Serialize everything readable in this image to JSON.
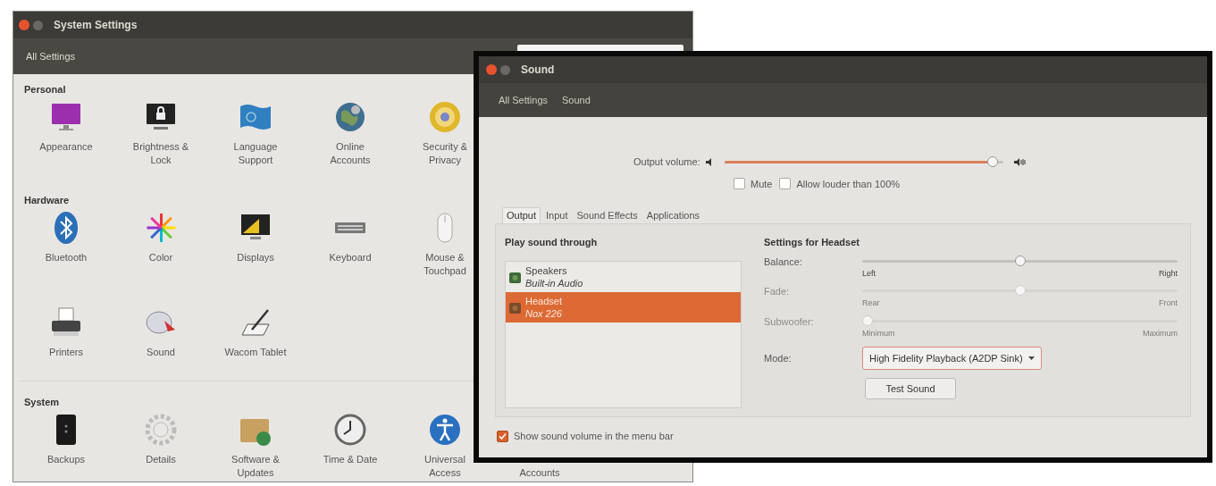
{
  "settings_window": {
    "title": "System Settings",
    "toolbar": {
      "button": "All Settings"
    },
    "sections": [
      {
        "heading": "Personal",
        "rows": [
          [
            {
              "kind": "tile",
              "label": "Appearance"
            },
            {
              "kind": "tile",
              "label": "Brightness &\nLock"
            },
            {
              "kind": "tile",
              "label": "Language\nSupport"
            },
            {
              "kind": "tile",
              "label": "Online\nAccounts"
            },
            {
              "kind": "tile",
              "label": "Security &\nPrivacy"
            }
          ]
        ]
      },
      {
        "heading": "Hardware",
        "rows": [
          [
            {
              "kind": "tile",
              "label": "Bluetooth"
            },
            {
              "kind": "tile",
              "label": "Color"
            },
            {
              "kind": "tile",
              "label": "Displays"
            },
            {
              "kind": "tile",
              "label": "Keyboard"
            },
            {
              "kind": "tile",
              "label": "Mouse &\nTouchpad"
            }
          ],
          [
            {
              "kind": "tile",
              "label": "Printers"
            },
            {
              "kind": "tile",
              "label": "Sound"
            },
            {
              "kind": "tile",
              "label": "Wacom Tablet"
            }
          ]
        ]
      },
      {
        "heading": "System",
        "rows": [
          [
            {
              "kind": "tile",
              "label": "Backups"
            },
            {
              "kind": "tile",
              "label": "Details"
            },
            {
              "kind": "tile",
              "label": "Software &\nUpdates"
            },
            {
              "kind": "tile",
              "label": "Time & Date"
            },
            {
              "kind": "tile",
              "label": "Universal\nAccess"
            },
            {
              "kind": "label_only",
              "label": "Accounts"
            }
          ]
        ]
      }
    ]
  },
  "sound_window": {
    "title": "Sound",
    "breadcrumbs": [
      "All Settings",
      "Sound"
    ],
    "output_volume": {
      "label": "Output volume:",
      "level": 0.98
    },
    "options": [
      {
        "label": "Mute",
        "checked": false
      },
      {
        "label": "Allow louder than 100%",
        "checked": false
      }
    ],
    "tabs": [
      {
        "label": "Output",
        "selected": true
      },
      {
        "label": "Input",
        "selected": false
      },
      {
        "label": "Sound Effects",
        "selected": false
      },
      {
        "label": "Applications",
        "selected": false
      }
    ],
    "devices": {
      "heading": "Play sound through",
      "items": [
        {
          "name": "Speakers",
          "detail": "Built-in Audio",
          "selected": false
        },
        {
          "name": "Headset",
          "detail": "Nox 226",
          "selected": true
        }
      ]
    },
    "settings": {
      "heading": "Settings for Headset",
      "sliders": [
        {
          "label": "Balance:",
          "level": 0.5,
          "disabled": false,
          "min_label": "Left",
          "max_label": "Right"
        },
        {
          "label": "Fade:",
          "level": 0.5,
          "disabled": true,
          "min_label": "Rear",
          "max_label": "Front"
        },
        {
          "label": "Subwoofer:",
          "level": 0,
          "disabled": true,
          "min_label": "Minimum",
          "max_label": "Maximum"
        }
      ],
      "mode": {
        "label": "Mode:",
        "value": "High Fidelity Playback (A2DP Sink)"
      },
      "test_button": "Test Sound"
    },
    "show_in_menu_bar": {
      "label": "Show sound volume in the menu bar",
      "checked": true
    }
  }
}
